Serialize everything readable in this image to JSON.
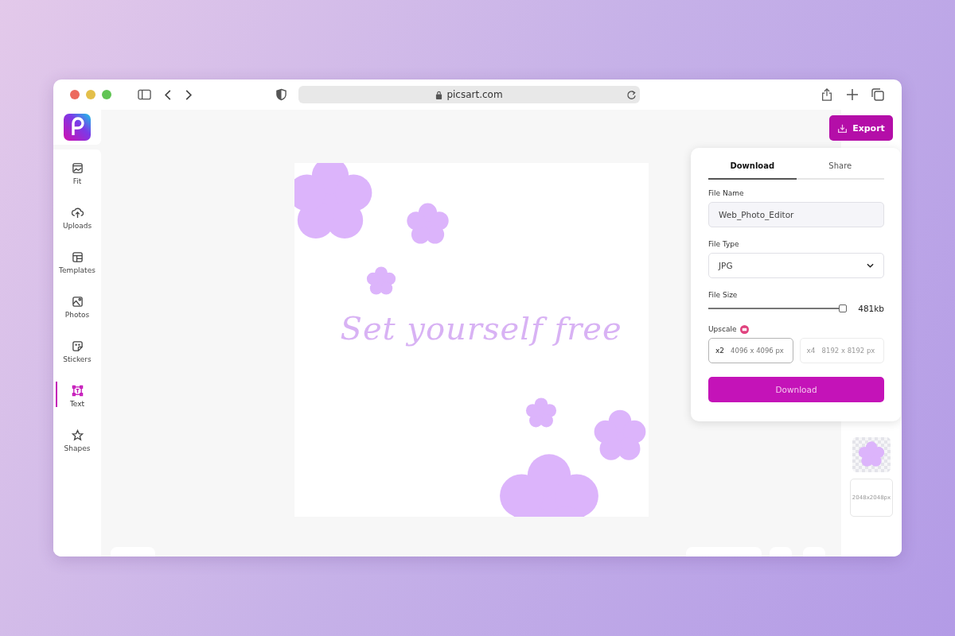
{
  "browser": {
    "url": "picsart.com"
  },
  "sidebar": {
    "items": [
      {
        "label": "Fit",
        "kind": "fit",
        "selected": false
      },
      {
        "label": "Uploads",
        "kind": "upload",
        "selected": false
      },
      {
        "label": "Templates",
        "kind": "templates",
        "selected": false
      },
      {
        "label": "Photos",
        "kind": "photos",
        "selected": false
      },
      {
        "label": "Stickers",
        "kind": "stickers",
        "selected": false
      },
      {
        "label": "Text",
        "kind": "text",
        "selected": true
      },
      {
        "label": "Shapes",
        "kind": "shapes",
        "selected": false
      }
    ]
  },
  "canvas": {
    "text": "Set yourself free"
  },
  "export_button": "Export",
  "export_panel": {
    "tabs": [
      {
        "label": "Download",
        "selected": true
      },
      {
        "label": "Share",
        "selected": false
      }
    ],
    "file_name": {
      "label": "File Name",
      "value": "Web_Photo_Editor"
    },
    "file_type": {
      "label": "File Type",
      "value": "JPG"
    },
    "file_size": {
      "label": "File Size",
      "level": 0.97,
      "reading": "481kb"
    },
    "upscale": {
      "label": "Upscale",
      "options": [
        {
          "factor": "x2",
          "size": "4096 x 4096 px",
          "selected": true,
          "disabled": false
        },
        {
          "factor": "x4",
          "size": "8192 x 8192 px",
          "selected": false,
          "disabled": true
        }
      ]
    },
    "download_button": "Download"
  },
  "layers": [
    {
      "kind": "flower"
    },
    {
      "kind": "size",
      "label": "2048x2048px"
    }
  ]
}
